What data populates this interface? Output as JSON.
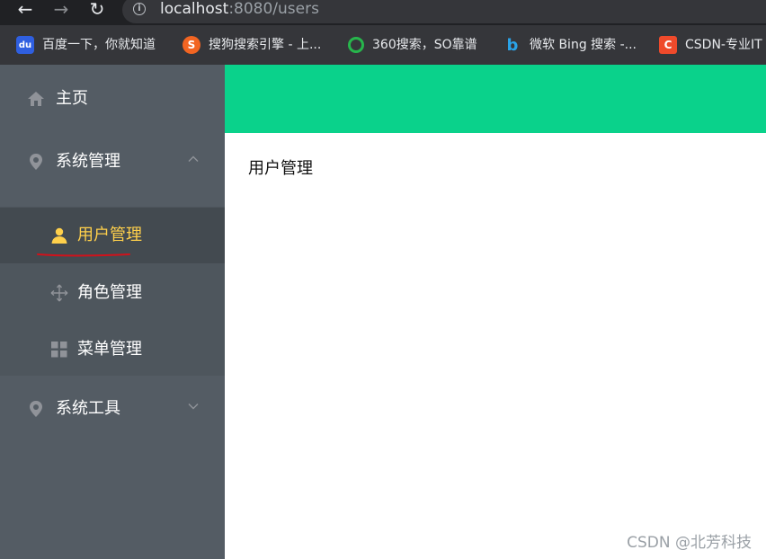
{
  "browser": {
    "url_host": "localhost",
    "url_rest": ":8080/users",
    "back_glyph": "←",
    "forward_glyph": "→",
    "reload_glyph": "↻",
    "info_glyph": "i"
  },
  "bookmarks": [
    {
      "label": "百度一下，你就知道",
      "icon": "baidu-icon",
      "icon_glyph": "du"
    },
    {
      "label": "搜狗搜索引擎 - 上...",
      "icon": "sogou-icon",
      "icon_glyph": "S"
    },
    {
      "label": "360搜索，SO靠谱",
      "icon": "360-icon",
      "icon_glyph": ""
    },
    {
      "label": "微软 Bing 搜索 -...",
      "icon": "bing-icon",
      "icon_glyph": "b"
    },
    {
      "label": "CSDN-专业IT",
      "icon": "csdn-icon",
      "icon_glyph": "C"
    }
  ],
  "sidebar": {
    "home": {
      "label": "主页",
      "icon": "home-icon"
    },
    "system_manage": {
      "label": "系统管理",
      "icon": "location-icon",
      "expanded": true
    },
    "submenu": [
      {
        "label": "用户管理",
        "icon": "user-icon",
        "active": true
      },
      {
        "label": "角色管理",
        "icon": "move-icon",
        "active": false
      },
      {
        "label": "菜单管理",
        "icon": "menu-grid-icon",
        "active": false
      }
    ],
    "system_tools": {
      "label": "系统工具",
      "icon": "location-icon",
      "expanded": false
    }
  },
  "main": {
    "title": "用户管理"
  },
  "watermark": "CSDN @北芳科技",
  "colors": {
    "header": "#0ad28b",
    "sidebar": "#545c64",
    "active_text": "#ffd04b",
    "underline": "#d0121b"
  }
}
